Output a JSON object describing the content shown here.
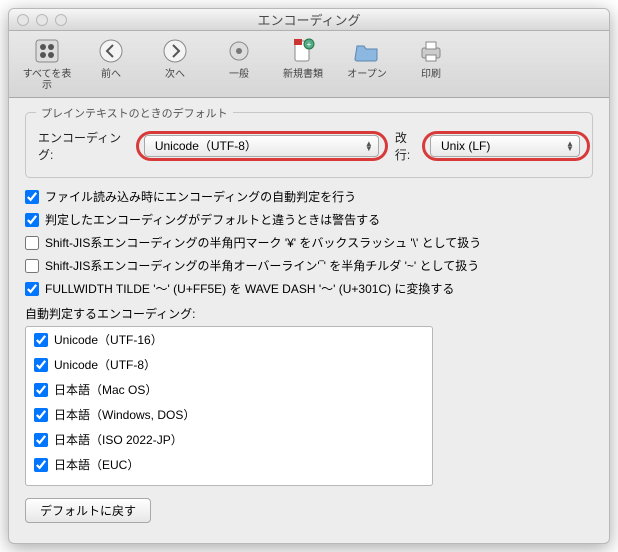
{
  "window": {
    "title": "エンコーディング"
  },
  "toolbar": [
    {
      "label": "すべてを表示",
      "icon": "grid"
    },
    {
      "label": "前へ",
      "icon": "back"
    },
    {
      "label": "次へ",
      "icon": "forward"
    },
    {
      "label": "一般",
      "icon": "gear"
    },
    {
      "label": "新規書類",
      "icon": "newdoc"
    },
    {
      "label": "オープン",
      "icon": "folder"
    },
    {
      "label": "印刷",
      "icon": "printer"
    }
  ],
  "group": {
    "title": "プレインテキストのときのデフォルト",
    "encoding_label": "エンコーディング:",
    "encoding_value": "Unicode（UTF-8）",
    "linebreak_label": "改行:",
    "linebreak_value": "Unix (LF)"
  },
  "checks": [
    {
      "label": "ファイル読み込み時にエンコーディングの自動判定を行う",
      "checked": true
    },
    {
      "label": "判定したエンコーディングがデフォルトと違うときは警告する",
      "checked": true
    },
    {
      "label": "Shift-JIS系エンコーディングの半角円マーク '¥' をバックスラッシュ '\\' として扱う",
      "checked": false
    },
    {
      "label": "Shift-JIS系エンコーディングの半角オーバーライン'‾' を半角チルダ '~' として扱う",
      "checked": false
    },
    {
      "label": "FULLWIDTH TILDE '〜' (U+FF5E) を WAVE DASH '〜' (U+301C) に変換する",
      "checked": true
    }
  ],
  "list_label": "自動判定するエンコーディング:",
  "encodings": [
    {
      "label": "Unicode（UTF-16）",
      "checked": true
    },
    {
      "label": "Unicode（UTF-8）",
      "checked": true
    },
    {
      "label": "日本語（Mac OS）",
      "checked": true
    },
    {
      "label": "日本語（Windows, DOS）",
      "checked": true
    },
    {
      "label": "日本語（ISO 2022-JP）",
      "checked": true
    },
    {
      "label": "日本語（EUC）",
      "checked": true
    }
  ],
  "reset_button": "デフォルトに戻す"
}
